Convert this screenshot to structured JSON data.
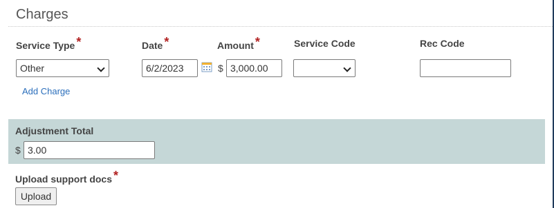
{
  "section": {
    "title": "Charges"
  },
  "charges": {
    "columns": {
      "service_type": "Service Type",
      "date": "Date",
      "amount": "Amount",
      "service_code": "Service Code",
      "rec_code": "Rec Code"
    },
    "required_marker": "*",
    "row": {
      "service_type": "Other",
      "date": "6/2/2023",
      "currency_symbol": "$",
      "amount": "3,000.00",
      "service_code": "",
      "rec_code": ""
    },
    "add_charge_label": "Add Charge"
  },
  "adjustment": {
    "label": "Adjustment Total",
    "currency_symbol": "$",
    "value": "3.00"
  },
  "upload": {
    "label": "Upload support docs",
    "button_label": "Upload"
  },
  "icons": {
    "calendar": "calendar-icon",
    "dropdown": "chevron-down-icon"
  },
  "colors": {
    "panel_bg": "#c5d7d7",
    "required": "#b22222",
    "link": "#2a6ebb"
  }
}
